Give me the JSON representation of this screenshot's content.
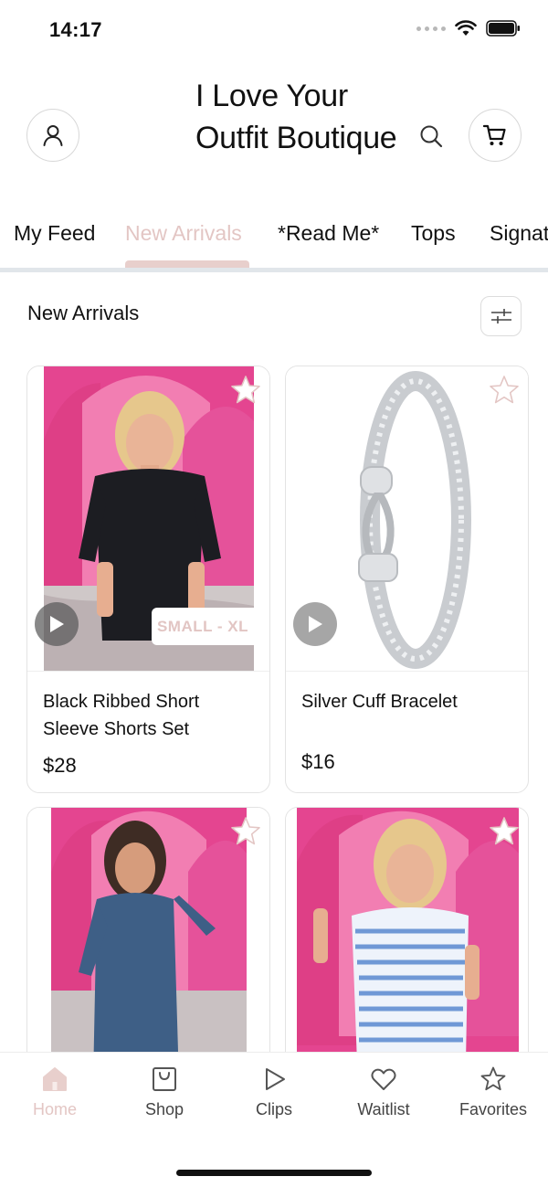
{
  "status_bar": {
    "time": "14:17"
  },
  "header": {
    "store_title": "I Love Your Outfit Boutique",
    "icons": [
      "user-icon",
      "search-icon",
      "cart-icon"
    ]
  },
  "tabs": [
    {
      "label": "My Feed",
      "active": false
    },
    {
      "label": "New Arrivals",
      "active": true
    },
    {
      "label": "*Read Me*",
      "active": false
    },
    {
      "label": "Tops",
      "active": false
    },
    {
      "label": "Signat",
      "active": false
    }
  ],
  "section": {
    "title": "New Arrivals"
  },
  "products": [
    {
      "name": "Black Ribbed Short Sleeve Shorts Set",
      "price": "$28",
      "badge": "SMALL - XL",
      "has_video": true
    },
    {
      "name": "Silver Cuff Bracelet",
      "price": "$16",
      "badge": "",
      "has_video": true
    },
    {
      "name": "",
      "price": "",
      "badge": "",
      "has_video": true
    },
    {
      "name": "",
      "price": "",
      "badge": "",
      "has_video": true
    }
  ],
  "bottom_nav": [
    {
      "label": "Home",
      "icon": "home-icon",
      "active": true
    },
    {
      "label": "Shop",
      "icon": "shopping-bag-icon",
      "active": false
    },
    {
      "label": "Clips",
      "icon": "play-icon",
      "active": false
    },
    {
      "label": "Waitlist",
      "icon": "heart-icon",
      "active": false
    },
    {
      "label": "Favorites",
      "icon": "star-icon",
      "active": false
    }
  ],
  "colors": {
    "accent": "#e3c6c4",
    "accent_strong": "#e8cfcc",
    "pink_backdrop": "#e44590",
    "divider": "#e1e6ea"
  }
}
